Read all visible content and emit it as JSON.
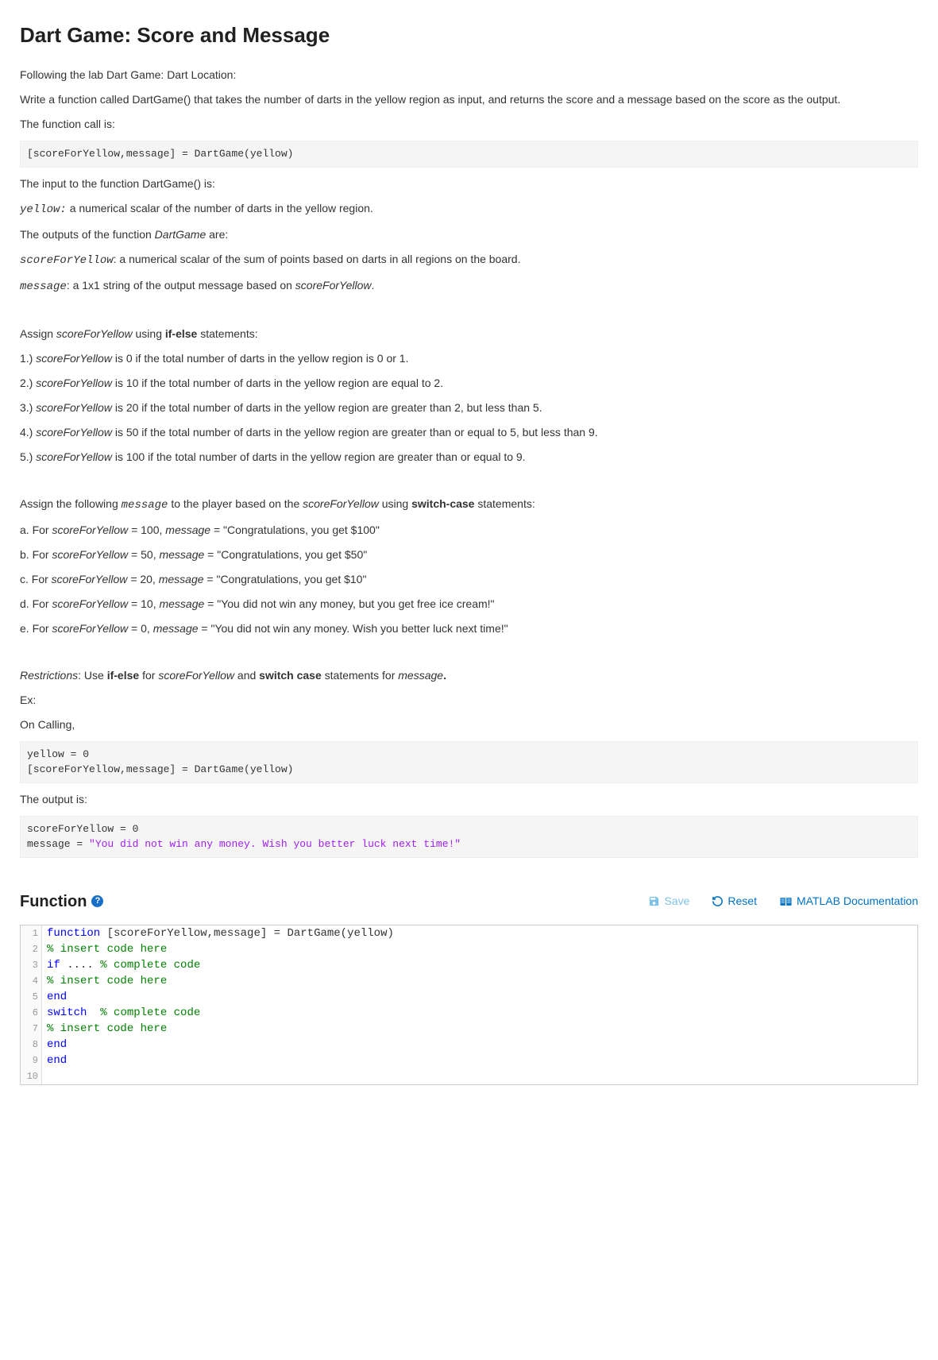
{
  "title": "Dart Game: Score and Message",
  "p1": "Following the lab Dart Game: Dart Location:",
  "p2": "Write a function called DartGame() that takes the number of darts in the yellow region as input, and returns the score and a message based on the score as the output.",
  "p3": "The function call is:",
  "code1": "[scoreForYellow,message] = DartGame(yellow)",
  "p4": "The input to the function DartGame() is:",
  "yellow_lbl": "yellow:",
  "yellow_desc": " a numerical scalar of the number of darts in the yellow region.",
  "p6a": "The outputs of the function ",
  "p6b": "DartGame",
  "p6c": " are:",
  "sfy_lbl": "scoreForYellow",
  "sfy_desc": ": a numerical scalar of the sum of points based on darts in all regions on the board.",
  "msg_lbl": "message",
  "msg_desc1": ": a 1x1 string of the output message based on ",
  "msg_desc2": "scoreForYellow",
  "msg_desc3": ".",
  "assign_sfya": "Assign ",
  "assign_sfyb": "scoreForYellow",
  "assign_sfyc": " using ",
  "assign_sfyd": "if-else",
  "assign_sfye": " statements:",
  "r1a": "1.) ",
  "r1b": "scoreForYellow",
  "r1c": " is 0 if the total number of darts in the yellow region is 0 or 1.",
  "r2a": "2.) ",
  "r2b": "scoreForYellow",
  "r2c": " is 10 if the total number of darts in the yellow region are equal to 2.",
  "r3a": "3.) ",
  "r3b": "scoreForYellow",
  "r3c": " is 20 if the total number of darts in the yellow region are greater than 2, but less than 5.",
  "r4a": "4.) ",
  "r4b": "scoreForYellow",
  "r4c": " is 50 if the total number of darts in the yellow region are greater than or equal to 5, but less than 9.",
  "r5a": "5.) ",
  "r5b": "scoreForYellow",
  "r5c": " is 100 if the total number of darts in the yellow region are greater than or equal to 9.",
  "assign_msga": "Assign the following ",
  "assign_msgb": "message",
  "assign_msgc": " to the player based on the ",
  "assign_msgd": "scoreForYellow",
  "assign_msge": " using ",
  "assign_msgf": "switch-case",
  "assign_msgg": " statements:",
  "ca1": "a. For ",
  "ca2": "scoreForYellow = ",
  "ca3": "100, ",
  "ca4": "message",
  "ca5": " =  \"Congratulations, you get $100\"",
  "cb1": "b. For ",
  "cb2": "scoreForYellow",
  "cb3": " = 50, ",
  "cb4": "message",
  "cb5": " = \"Congratulations, you get $50\"",
  "cc1": "c. For ",
  "cc2": "scoreForYellow = ",
  "cc3": "20, ",
  "cc4": "message",
  "cc5": " =  \"Congratulations, you get $10\"",
  "cd1": "d. For ",
  "cd2": "scoreForYellow",
  "cd3": " = 10, ",
  "cd4": "message",
  "cd5": " = \"You did not win any money, but you get free ice cream!\"",
  "ce1": "e. For ",
  "ce2": "scoreForYellow",
  "ce3": " = 0, ",
  "ce4": "message",
  "ce5": " =  \"You did not win any money. Wish you better luck next time!\"",
  "restr1": "Restrictions",
  "restr2": ": Use ",
  "restr3": "if-else",
  "restr4": " for ",
  "restr5": "scoreForYellow",
  "restr6": " and ",
  "restr7": "switch case",
  "restr8": " statements for ",
  "restr9": "message",
  "restr10": ".",
  "ex_lbl": "Ex:",
  "oncall": "On Calling,",
  "code2a": "yellow = 0",
  "code2b": "[scoreForYellow,message] = DartGame(yellow)",
  "outis": "The output is:",
  "code3a": "scoreForYellow = 0",
  "code3b": "message = ",
  "code3c": "\"You did not win any money. Wish you better luck next time!\"",
  "func_title": "Function",
  "actions": {
    "save": "Save",
    "reset": "Reset",
    "doc": "MATLAB Documentation"
  },
  "editor": {
    "lines": [
      {
        "n": "1",
        "segs": [
          {
            "c": "kw",
            "t": "function"
          },
          {
            "c": "",
            "t": " [scoreForYellow,message] = DartGame(yellow)"
          }
        ]
      },
      {
        "n": "2",
        "segs": [
          {
            "c": "com",
            "t": "% insert code here"
          }
        ]
      },
      {
        "n": "3",
        "segs": [
          {
            "c": "kw",
            "t": "if"
          },
          {
            "c": "",
            "t": " .... "
          },
          {
            "c": "com",
            "t": "% complete code"
          }
        ]
      },
      {
        "n": "4",
        "segs": [
          {
            "c": "com",
            "t": "% insert code here"
          }
        ]
      },
      {
        "n": "5",
        "segs": [
          {
            "c": "kw",
            "t": "end"
          }
        ]
      },
      {
        "n": "6",
        "segs": [
          {
            "c": "kw",
            "t": "switch"
          },
          {
            "c": "",
            "t": "  "
          },
          {
            "c": "com",
            "t": "% complete code"
          }
        ]
      },
      {
        "n": "7",
        "segs": [
          {
            "c": "com",
            "t": "% insert code here"
          }
        ]
      },
      {
        "n": "8",
        "segs": [
          {
            "c": "kw",
            "t": "end"
          }
        ]
      },
      {
        "n": "9",
        "segs": [
          {
            "c": "kw",
            "t": "end"
          }
        ]
      },
      {
        "n": "10",
        "segs": [
          {
            "c": "",
            "t": ""
          }
        ]
      }
    ]
  }
}
